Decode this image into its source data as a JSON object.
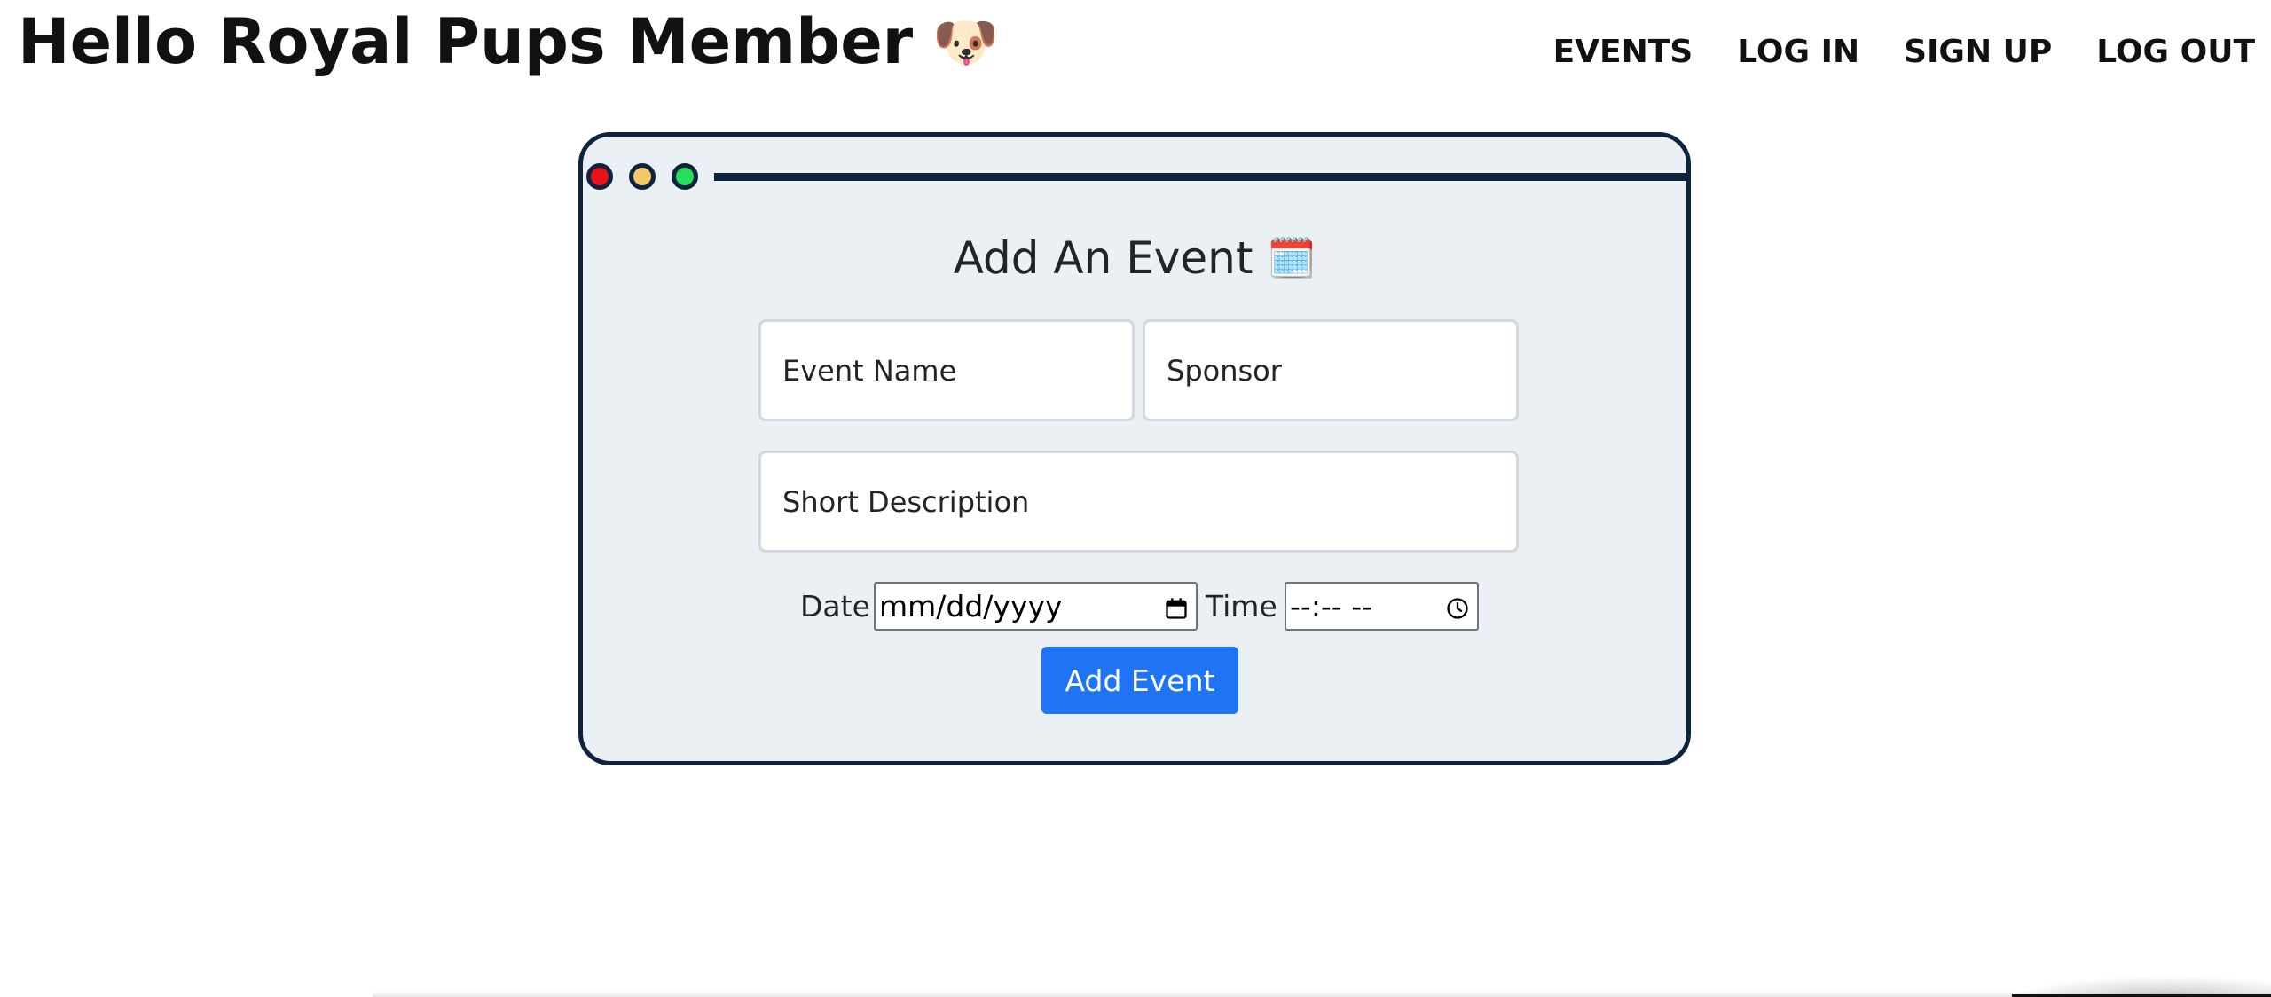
{
  "header": {
    "title": "Hello Royal Pups Member",
    "title_emoji": "🐶"
  },
  "nav": {
    "items": [
      {
        "label": "EVENTS"
      },
      {
        "label": "LOG IN"
      },
      {
        "label": "SIGN UP"
      },
      {
        "label": "LOG OUT"
      }
    ]
  },
  "window": {
    "dots": [
      {
        "name": "close",
        "color": "#e8141a"
      },
      {
        "name": "minimize",
        "color": "#f5c96a"
      },
      {
        "name": "maximize",
        "color": "#27e05a"
      }
    ],
    "frame_color": "#0d2340",
    "background": "#eaf0f3"
  },
  "form": {
    "title": "Add An Event",
    "title_emoji": "🗓️",
    "event_name": {
      "value": "",
      "placeholder": "Event Name"
    },
    "sponsor": {
      "value": "",
      "placeholder": "Sponsor"
    },
    "description": {
      "value": "",
      "placeholder": "Short Description"
    },
    "date": {
      "label": "Date",
      "value": "mm/dd/yyyy",
      "icon": "calendar-icon"
    },
    "time": {
      "label": "Time",
      "value": "--:-- --",
      "icon": "clock-icon"
    },
    "submit_label": "Add Event",
    "submit_color": "#1f74f5"
  }
}
